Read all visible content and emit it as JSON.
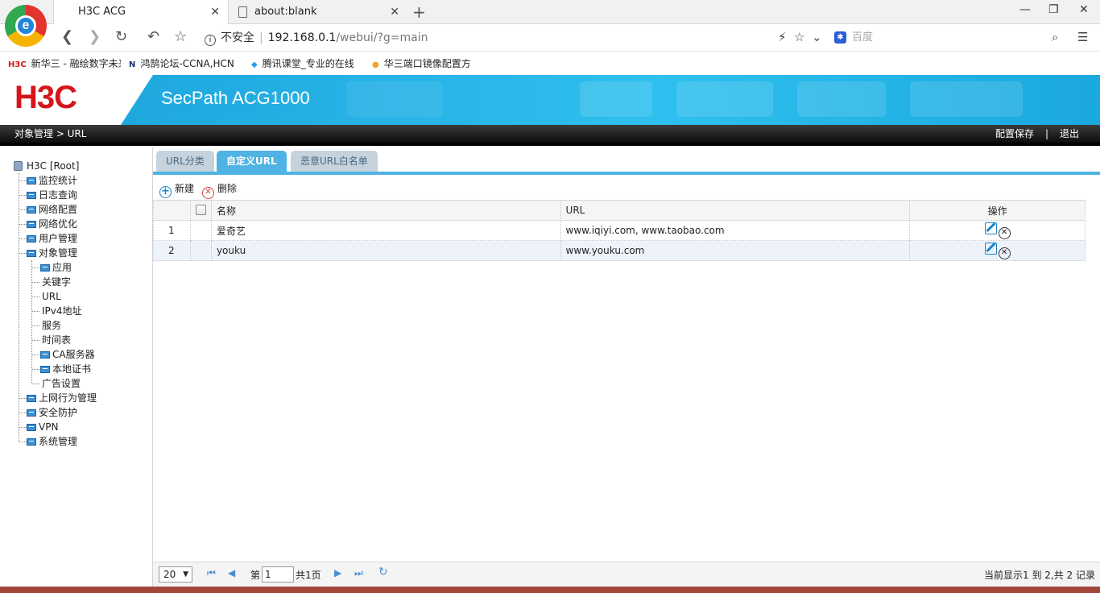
{
  "browser": {
    "tabs": [
      {
        "title": "H3C ACG",
        "close": "✕"
      },
      {
        "title": "about:blank",
        "close": "✕"
      }
    ],
    "new_tab": "+",
    "window": {
      "minimize": "—",
      "maximize": "❐",
      "close": "✕"
    },
    "logo_letter": "e",
    "security_label": "不安全",
    "url_host": "192.168.0.1",
    "url_path": "/webui/?g=main",
    "search_placeholder": "百度",
    "bookmarks": [
      {
        "icon": "H3C",
        "label": "新华三 - 融绘数字未来"
      },
      {
        "icon": "N",
        "label": "鸿鹄论坛-CCNA,HCN"
      },
      {
        "icon": "◆",
        "label": "腾讯课堂_专业的在线"
      },
      {
        "icon": "●",
        "label": "华三端口镜像配置方"
      }
    ]
  },
  "app": {
    "logo": "H3C",
    "product": "SecPath ACG1000",
    "breadcrumb": "对象管理 > URL",
    "save_config": "配置保存",
    "divider": "|",
    "logout": "退出"
  },
  "tree": {
    "root": "H3C [Root]",
    "items": [
      {
        "label": "监控统计"
      },
      {
        "label": "日志查询"
      },
      {
        "label": "网络配置"
      },
      {
        "label": "网络优化"
      },
      {
        "label": "用户管理"
      },
      {
        "label": "对象管理"
      },
      {
        "label": "应用"
      },
      {
        "label": "关键字"
      },
      {
        "label": "URL"
      },
      {
        "label": "IPv4地址"
      },
      {
        "label": "服务"
      },
      {
        "label": "时间表"
      },
      {
        "label": "CA服务器"
      },
      {
        "label": "本地证书"
      },
      {
        "label": "广告设置"
      },
      {
        "label": "上网行为管理"
      },
      {
        "label": "安全防护"
      },
      {
        "label": "VPN"
      },
      {
        "label": "系统管理"
      }
    ]
  },
  "content": {
    "tabs": [
      {
        "label": "URL分类"
      },
      {
        "label": "自定义URL"
      },
      {
        "label": "恶意URL白名单"
      }
    ],
    "toolbar": {
      "add": "新建",
      "delete": "删除"
    },
    "columns": {
      "name": "名称",
      "url": "URL",
      "ops": "操作"
    },
    "rows": [
      {
        "index": "1",
        "name": "爱奇艺",
        "url": "www.iqiyi.com, www.taobao.com"
      },
      {
        "index": "2",
        "name": "youku",
        "url": "www.youku.com"
      }
    ],
    "pager": {
      "page_size": "20",
      "page_prefix": "第",
      "page_value": "1",
      "page_suffix": "共1页",
      "summary": "当前显示1 到 2,共 2 记录"
    }
  }
}
